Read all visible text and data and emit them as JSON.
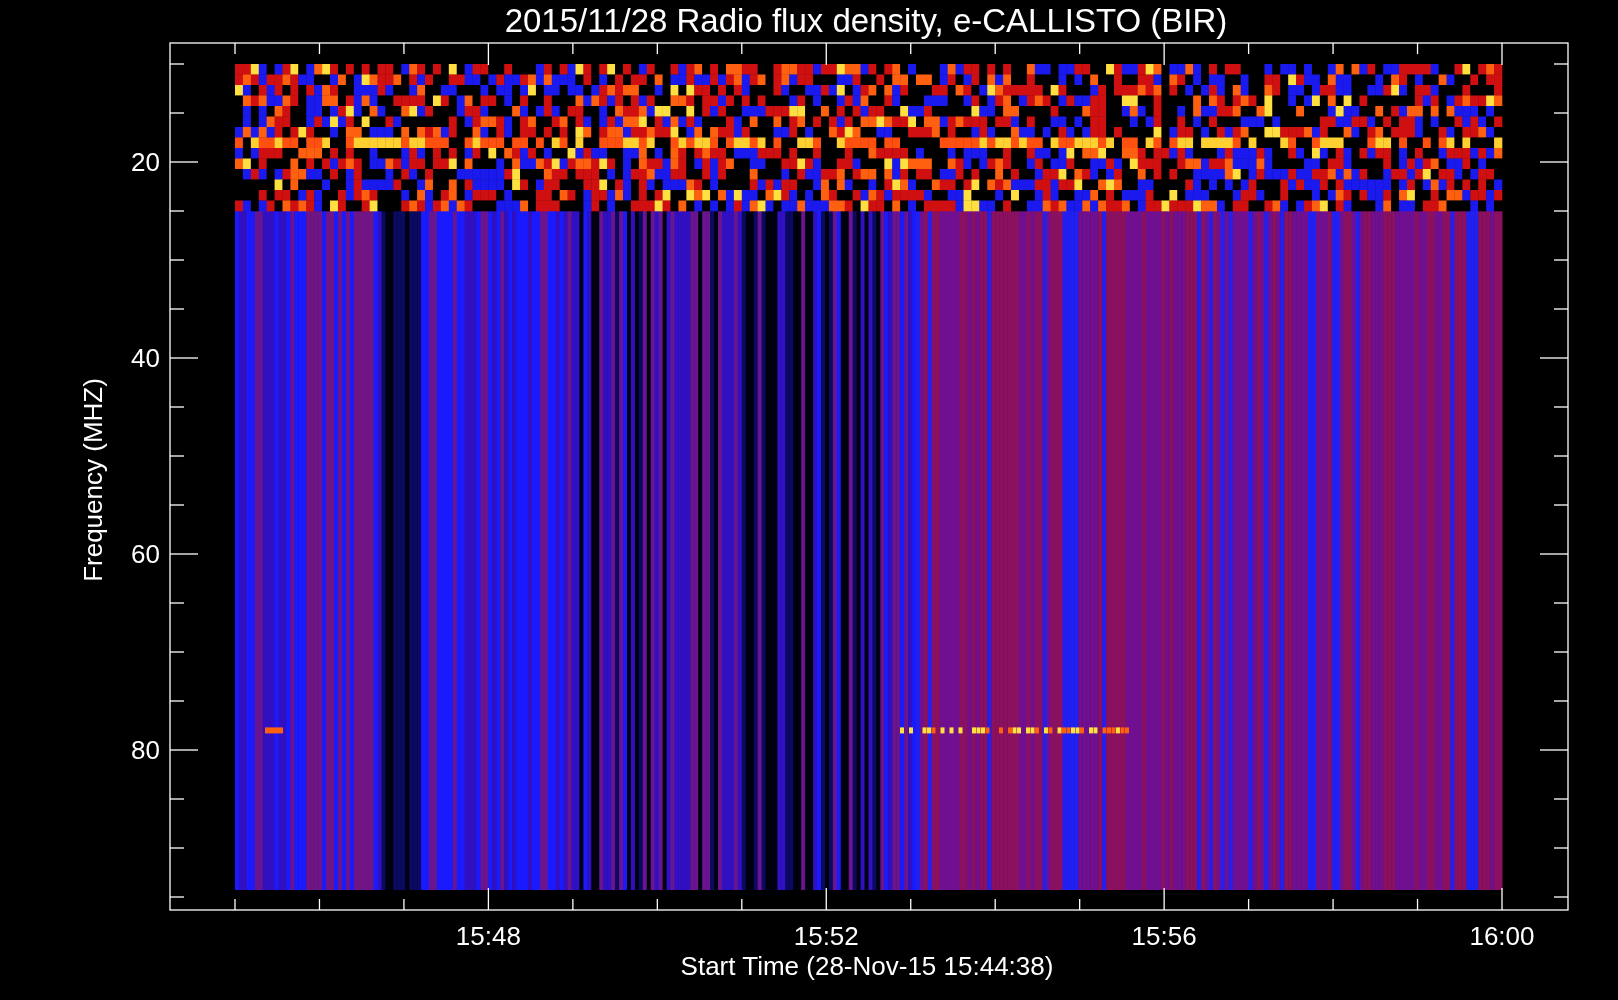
{
  "title": "2015/11/28  Radio flux density, e-CALLISTO (BIR)",
  "y_axis": {
    "label": "Frequency (MHZ)",
    "ticks": [
      "20",
      "40",
      "60",
      "80"
    ]
  },
  "x_axis": {
    "label": "Start Time (28-Nov-15 15:44:38)",
    "ticks": [
      "15:48",
      "15:52",
      "15:56",
      "16:00"
    ]
  }
}
